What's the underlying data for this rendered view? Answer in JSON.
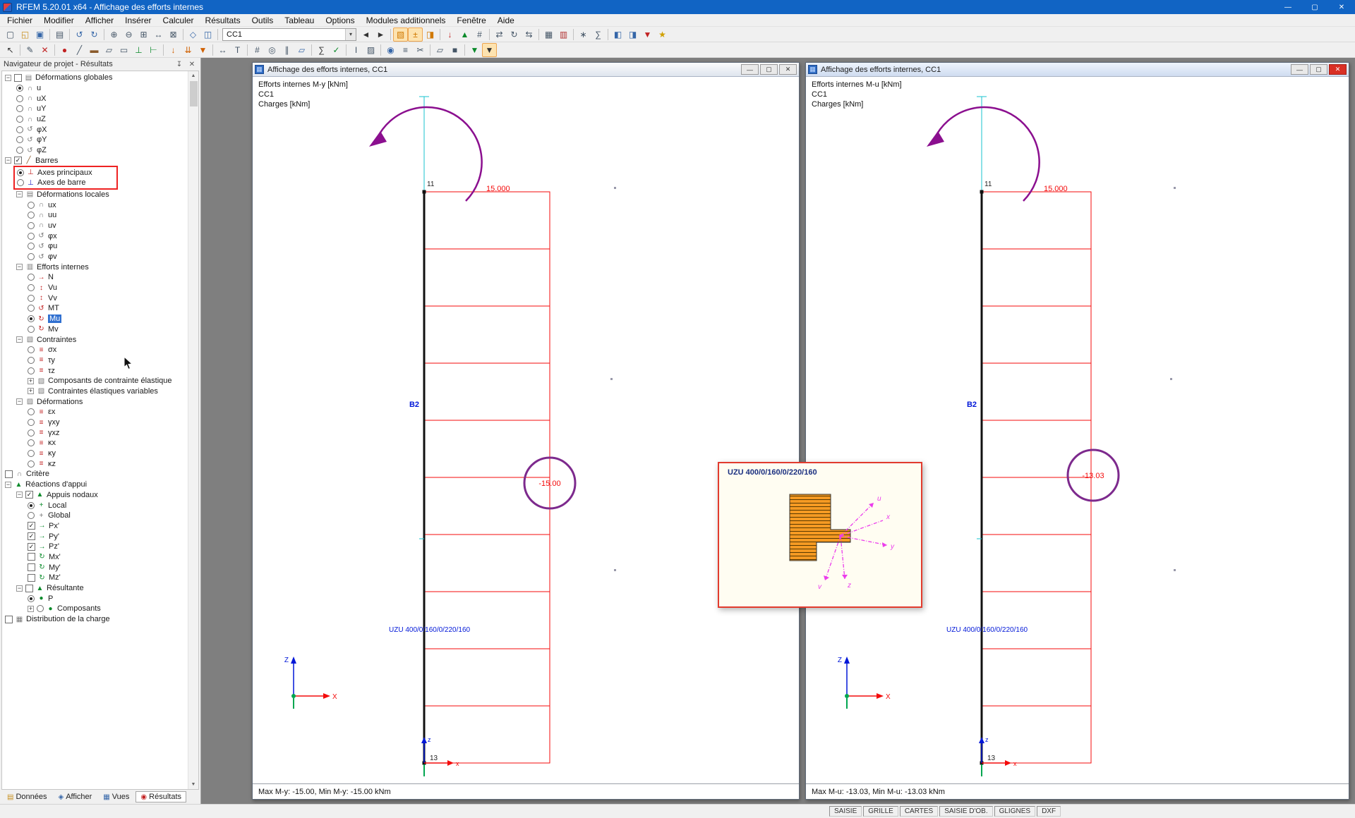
{
  "titlebar": {
    "title": "RFEM 5.20.01 x64 - Affichage des efforts internes"
  },
  "glyphs": {
    "minimize": "—",
    "maximize": "▢",
    "close": "✕",
    "pin": "↧",
    "dropdown": "▾",
    "window": "▦",
    "scroll_up": "▲",
    "scroll_down": "▼"
  },
  "menu": {
    "items": [
      "Fichier",
      "Modifier",
      "Afficher",
      "Insérer",
      "Calculer",
      "Résultats",
      "Outils",
      "Tableau",
      "Options",
      "Modules additionnels",
      "Fenêtre",
      "Aide"
    ]
  },
  "toolbars": {
    "row1": [
      {
        "n": "new-file-button",
        "g": "▢",
        "c": "#456"
      },
      {
        "n": "open-file-button",
        "g": "◱",
        "c": "#c89020"
      },
      {
        "n": "save-button",
        "g": "▣",
        "c": "#3566a8"
      },
      {
        "t": "s"
      },
      {
        "n": "print-button",
        "g": "▤",
        "c": "#456"
      },
      {
        "t": "s"
      },
      {
        "n": "undo-button",
        "g": "↺",
        "c": "#3566a8"
      },
      {
        "n": "redo-button",
        "g": "↻",
        "c": "#3566a8"
      },
      {
        "t": "s"
      },
      {
        "n": "zoom-in-button",
        "g": "⊕",
        "c": "#456"
      },
      {
        "n": "zoom-out-button",
        "g": "⊖",
        "c": "#456"
      },
      {
        "n": "zoom-window-button",
        "g": "⊞",
        "c": "#456"
      },
      {
        "n": "pan-button",
        "g": "↔",
        "c": "#456"
      },
      {
        "n": "zoom-all-button",
        "g": "⊠",
        "c": "#456"
      },
      {
        "t": "s"
      },
      {
        "n": "isometric-view-button",
        "g": "◇",
        "c": "#3566a8"
      },
      {
        "n": "view-xz-button",
        "g": "◫",
        "c": "#3566a8"
      },
      {
        "t": "s"
      },
      {
        "t": "combo",
        "v": "CC1"
      },
      {
        "n": "previous-load-case-button",
        "g": "◄",
        "c": "#333"
      },
      {
        "n": "next-load-case-button",
        "g": "►",
        "c": "#333"
      },
      {
        "t": "s"
      },
      {
        "n": "show-results-button",
        "g": "▧",
        "c": "#d07800",
        "hl": 1
      },
      {
        "n": "show-result-values-button",
        "g": "±",
        "c": "#d07800",
        "hl": 1
      },
      {
        "n": "result-panel-button",
        "g": "◨",
        "c": "#d07800"
      },
      {
        "t": "s"
      },
      {
        "n": "show-loads-button",
        "g": "↓",
        "c": "#c22222"
      },
      {
        "n": "show-supports-button",
        "g": "▲",
        "c": "#0a8a2a"
      },
      {
        "n": "numbering-button",
        "g": "#",
        "c": "#456"
      },
      {
        "t": "s"
      },
      {
        "n": "move-copy-button",
        "g": "⇄",
        "c": "#456"
      },
      {
        "n": "rotate-button",
        "g": "↻",
        "c": "#456"
      },
      {
        "n": "mirror-button",
        "g": "⇆",
        "c": "#456"
      },
      {
        "t": "s"
      },
      {
        "n": "tables-button",
        "g": "▦",
        "c": "#456"
      },
      {
        "n": "printout-report-button",
        "g": "▥",
        "c": "#b03030"
      },
      {
        "t": "s"
      },
      {
        "n": "modules-button",
        "g": "∗",
        "c": "#456"
      },
      {
        "n": "calculation-button",
        "g": "∑",
        "c": "#456"
      },
      {
        "t": "s"
      },
      {
        "n": "panel-left-button",
        "g": "◧",
        "c": "#3566a8"
      },
      {
        "n": "panel-right-button",
        "g": "◨",
        "c": "#3566a8"
      },
      {
        "n": "pdf-export-button",
        "g": "▼",
        "c": "#c22222"
      },
      {
        "n": "settings-button",
        "g": "★",
        "c": "#d0a000"
      }
    ],
    "row2": [
      {
        "n": "select-button",
        "g": "↖",
        "c": "#333"
      },
      {
        "t": "s"
      },
      {
        "n": "edit-mode-button",
        "g": "✎",
        "c": "#456"
      },
      {
        "n": "delete-button",
        "g": "✕",
        "c": "#c22222"
      },
      {
        "t": "s"
      },
      {
        "n": "new-node-button",
        "g": "●",
        "c": "#c22222"
      },
      {
        "n": "new-line-button",
        "g": "╱",
        "c": "#456"
      },
      {
        "n": "new-member-button",
        "g": "▬",
        "c": "#8a5a2a"
      },
      {
        "n": "new-surface-button",
        "g": "▱",
        "c": "#456"
      },
      {
        "n": "new-opening-button",
        "g": "▭",
        "c": "#456"
      },
      {
        "n": "nodal-support-button",
        "g": "⊥",
        "c": "#0a8a2a"
      },
      {
        "n": "line-support-button",
        "g": "⊢",
        "c": "#0a8a2a"
      },
      {
        "t": "s"
      },
      {
        "n": "nodal-load-button",
        "g": "↓",
        "c": "#d06000"
      },
      {
        "n": "member-load-button",
        "g": "⇊",
        "c": "#d06000"
      },
      {
        "n": "surface-load-button",
        "g": "▼",
        "c": "#d06000"
      },
      {
        "t": "s"
      },
      {
        "n": "dimension-button",
        "g": "↔",
        "c": "#456"
      },
      {
        "n": "comment-button",
        "g": "T",
        "c": "#456"
      },
      {
        "t": "s"
      },
      {
        "n": "grid-button",
        "g": "#",
        "c": "#456"
      },
      {
        "n": "snap-button",
        "g": "◎",
        "c": "#456"
      },
      {
        "n": "guidelines-button",
        "g": "∥",
        "c": "#456"
      },
      {
        "n": "work-plane-button",
        "g": "▱",
        "c": "#3566a8"
      },
      {
        "t": "s"
      },
      {
        "n": "calculate-button",
        "g": "∑",
        "c": "#333"
      },
      {
        "n": "check-model-button",
        "g": "✓",
        "c": "#0a8a2a"
      },
      {
        "t": "s"
      },
      {
        "n": "cross-section-button",
        "g": "I",
        "c": "#456"
      },
      {
        "n": "material-button",
        "g": "▨",
        "c": "#456"
      },
      {
        "t": "s"
      },
      {
        "n": "visibility-button",
        "g": "◉",
        "c": "#3566a8"
      },
      {
        "n": "layers-button",
        "g": "≡",
        "c": "#456"
      },
      {
        "n": "clip-button",
        "g": "✂",
        "c": "#456"
      },
      {
        "t": "s"
      },
      {
        "n": "wireframe-button",
        "g": "▱",
        "c": "#456"
      },
      {
        "n": "solid-view-button",
        "g": "■",
        "c": "#456"
      },
      {
        "t": "s"
      },
      {
        "n": "color-scale-button",
        "g": "▼",
        "c": "#0a8a2a"
      },
      {
        "n": "display-properties-button",
        "g": "▼",
        "c": "#333",
        "hl": 1
      }
    ]
  },
  "navigator": {
    "title": "Navigateur de projet - Résultats",
    "tree": [
      {
        "l": 0,
        "e": "m",
        "c": "c0",
        "i": "global-deformations-icon",
        "g": "▤",
        "k": "#777",
        "t": "Déformations globales"
      },
      {
        "l": 1,
        "c": "r1",
        "i": "deformation-u-icon",
        "g": "∩",
        "k": "#777",
        "t": "u"
      },
      {
        "l": 1,
        "c": "r0",
        "i": "deformation-ux-icon",
        "g": "∩",
        "k": "#777",
        "t": "uX"
      },
      {
        "l": 1,
        "c": "r0",
        "i": "deformation-uy-icon",
        "g": "∩",
        "k": "#777",
        "t": "uY"
      },
      {
        "l": 1,
        "c": "r0",
        "i": "deformation-uz-icon",
        "g": "∩",
        "k": "#777",
        "t": "uZ"
      },
      {
        "l": 1,
        "c": "r0",
        "i": "rotation-phix-icon",
        "g": "↺",
        "k": "#777",
        "t": "φX"
      },
      {
        "l": 1,
        "c": "r0",
        "i": "rotation-phiy-icon",
        "g": "↺",
        "k": "#777",
        "t": "φY"
      },
      {
        "l": 1,
        "c": "r0",
        "i": "rotation-phiz-icon",
        "g": "↺",
        "k": "#777",
        "t": "φZ"
      },
      {
        "l": 0,
        "e": "m",
        "c": "c1",
        "i": "members-icon",
        "g": "╱",
        "k": "#8a5a2a",
        "t": "Barres"
      },
      {
        "l": 1,
        "c": "r1",
        "i": "principal-axes-icon",
        "g": "⊥",
        "k": "#c22222",
        "t": "Axes principaux",
        "grp": 1
      },
      {
        "l": 1,
        "c": "r0",
        "i": "member-axes-icon",
        "g": "⊥",
        "k": "#2222c2",
        "t": "Axes de barre",
        "grp": 1
      },
      {
        "l": 1,
        "e": "m",
        "i": "local-deformations-icon",
        "g": "▤",
        "k": "#777",
        "t": "Déformations locales"
      },
      {
        "l": 2,
        "c": "r0",
        "i": "deformation-ux-icon",
        "g": "∩",
        "k": "#777",
        "t": "ux"
      },
      {
        "l": 2,
        "c": "r0",
        "i": "deformation-uu-icon",
        "g": "∩",
        "k": "#777",
        "t": "uu"
      },
      {
        "l": 2,
        "c": "r0",
        "i": "deformation-uv-icon",
        "g": "∩",
        "k": "#777",
        "t": "uv"
      },
      {
        "l": 2,
        "c": "r0",
        "i": "rotation-phix-icon",
        "g": "↺",
        "k": "#777",
        "t": "φx"
      },
      {
        "l": 2,
        "c": "r0",
        "i": "rotation-phiu-icon",
        "g": "↺",
        "k": "#777",
        "t": "φu"
      },
      {
        "l": 2,
        "c": "r0",
        "i": "rotation-phiv-icon",
        "g": "↺",
        "k": "#777",
        "t": "φv"
      },
      {
        "l": 1,
        "e": "m",
        "i": "internal-forces-icon",
        "g": "▥",
        "k": "#777",
        "t": "Efforts internes"
      },
      {
        "l": 2,
        "c": "r0",
        "i": "axial-force-icon",
        "g": "→",
        "k": "#c22222",
        "t": "N"
      },
      {
        "l": 2,
        "c": "r0",
        "i": "shear-vu-icon",
        "g": "↕",
        "k": "#c22222",
        "t": "Vu"
      },
      {
        "l": 2,
        "c": "r0",
        "i": "shear-vv-icon",
        "g": "↕",
        "k": "#c22222",
        "t": "Vv"
      },
      {
        "l": 2,
        "c": "r0",
        "i": "torsion-mt-icon",
        "g": "↺",
        "k": "#c22222",
        "t": "MT"
      },
      {
        "l": 2,
        "c": "r1",
        "i": "moment-mu-icon",
        "g": "↻",
        "k": "#c22222",
        "t": "Mu",
        "sel": 1
      },
      {
        "l": 2,
        "c": "r0",
        "i": "moment-mv-icon",
        "g": "↻",
        "k": "#c22222",
        "t": "Mv"
      },
      {
        "l": 1,
        "e": "m",
        "i": "stresses-icon",
        "g": "▧",
        "k": "#777",
        "t": "Contraintes"
      },
      {
        "l": 2,
        "c": "r0",
        "i": "stress-sigma-x-icon",
        "g": "≡",
        "k": "#c22222",
        "t": "σx"
      },
      {
        "l": 2,
        "c": "r0",
        "i": "stress-tau-y-icon",
        "g": "≡",
        "k": "#c22222",
        "t": "τy"
      },
      {
        "l": 2,
        "c": "r0",
        "i": "stress-tau-z-icon",
        "g": "≡",
        "k": "#c22222",
        "t": "τz"
      },
      {
        "l": 2,
        "e": "p",
        "i": "stress-components-icon",
        "g": "▧",
        "k": "#777",
        "t": "Composants de contrainte élastique"
      },
      {
        "l": 2,
        "e": "p",
        "i": "variable-stresses-icon",
        "g": "▧",
        "k": "#777",
        "t": "Contraintes élastiques variables"
      },
      {
        "l": 1,
        "e": "m",
        "i": "strains-icon",
        "g": "▨",
        "k": "#777",
        "t": "Déformations"
      },
      {
        "l": 2,
        "c": "r0",
        "i": "strain-epsilon-x-icon",
        "g": "≡",
        "k": "#c22222",
        "t": "εx"
      },
      {
        "l": 2,
        "c": "r0",
        "i": "strain-gamma-xy-icon",
        "g": "≡",
        "k": "#c22222",
        "t": "γxy"
      },
      {
        "l": 2,
        "c": "r0",
        "i": "strain-gamma-xz-icon",
        "g": "≡",
        "k": "#c22222",
        "t": "γxz"
      },
      {
        "l": 2,
        "c": "r0",
        "i": "strain-kappa-x-icon",
        "g": "≡",
        "k": "#c22222",
        "t": "κx"
      },
      {
        "l": 2,
        "c": "r0",
        "i": "strain-kappa-y-icon",
        "g": "≡",
        "k": "#c22222",
        "t": "κy"
      },
      {
        "l": 2,
        "c": "r0",
        "i": "strain-kappa-z-icon",
        "g": "≡",
        "k": "#c22222",
        "t": "κz"
      },
      {
        "l": 0,
        "c": "c0",
        "i": "criterion-icon",
        "g": "∩",
        "k": "#777",
        "t": "Critère"
      },
      {
        "l": 0,
        "e": "m",
        "i": "support-reactions-icon",
        "g": "▲",
        "k": "#0a8a2a",
        "t": "Réactions d'appui"
      },
      {
        "l": 1,
        "e": "m",
        "c": "c1",
        "i": "nodal-supports-icon",
        "g": "▲",
        "k": "#0a8a2a",
        "t": "Appuis nodaux"
      },
      {
        "l": 2,
        "c": "r1",
        "i": "local-system-icon",
        "g": "+",
        "k": "#0a8a2a",
        "t": "Local"
      },
      {
        "l": 2,
        "c": "r0",
        "i": "global-system-icon",
        "g": "+",
        "k": "#777",
        "t": "Global"
      },
      {
        "l": 2,
        "c": "c1",
        "i": "reaction-px-icon",
        "g": "→",
        "k": "#0a8a2a",
        "t": "Px'"
      },
      {
        "l": 2,
        "c": "c1",
        "i": "reaction-py-icon",
        "g": "→",
        "k": "#0a8a2a",
        "t": "Py'"
      },
      {
        "l": 2,
        "c": "c1",
        "i": "reaction-pz-icon",
        "g": "→",
        "k": "#0a8a2a",
        "t": "Pz'"
      },
      {
        "l": 2,
        "c": "c0",
        "i": "reaction-mx-icon",
        "g": "↻",
        "k": "#0a8a2a",
        "t": "Mx'"
      },
      {
        "l": 2,
        "c": "c0",
        "i": "reaction-my-icon",
        "g": "↻",
        "k": "#0a8a2a",
        "t": "My'"
      },
      {
        "l": 2,
        "c": "c0",
        "i": "reaction-mz-icon",
        "g": "↻",
        "k": "#0a8a2a",
        "t": "Mz'"
      },
      {
        "l": 1,
        "e": "m",
        "c": "c0",
        "i": "resultant-icon",
        "g": "▲",
        "k": "#0a8a2a",
        "t": "Résultante"
      },
      {
        "l": 2,
        "c": "r1",
        "i": "resultant-p-icon",
        "g": "●",
        "k": "#0a8a2a",
        "t": "P"
      },
      {
        "l": 2,
        "e": "p",
        "c": "r0",
        "i": "components-icon",
        "g": "●",
        "k": "#0a8a2a",
        "t": "Composants"
      },
      {
        "l": 0,
        "c": "c0",
        "i": "load-distribution-icon",
        "g": "▦",
        "k": "#777",
        "t": "Distribution de la charge"
      }
    ],
    "tabs": [
      {
        "label": "Données",
        "glyph": "▤"
      },
      {
        "label": "Afficher",
        "glyph": "◈"
      },
      {
        "label": "Vues",
        "glyph": "▦"
      },
      {
        "label": "Résultats",
        "glyph": "◉"
      }
    ]
  },
  "mdi": {
    "windows": [
      {
        "title": "Affichage des efforts internes, CC1",
        "legend": [
          "Efforts internes M-y [kNm]",
          "CC1",
          "Charges [kNm]"
        ],
        "moment_label": "15.000",
        "value_circle": "-15.00",
        "node_top": "11",
        "node_bottom": "13",
        "member": "B2",
        "section": "UZU 400/0/160/0/220/160",
        "axis_x": "X",
        "axis_z": "Z",
        "axis_x_small": "x",
        "axis_z_small": "z",
        "status": "Max M-y: -15.00, Min M-y: -15.00 kNm"
      },
      {
        "title": "Affichage des efforts internes, CC1",
        "legend": [
          "Efforts internes M-u [kNm]",
          "CC1",
          "Charges [kNm]"
        ],
        "moment_label": "15.000",
        "value_circle": "-13.03",
        "node_top": "11",
        "node_bottom": "13",
        "member": "B2",
        "section": "UZU 400/0/160/0/220/160",
        "axis_x": "X",
        "axis_z": "Z",
        "axis_x_small": "x",
        "axis_z_small": "z",
        "status": "Max M-u: -13.03, Min M-u: -13.03 kNm"
      }
    ]
  },
  "popup": {
    "title": "UZU 400/0/160/0/220/160",
    "axes": {
      "u": "u",
      "v": "v",
      "x": "x",
      "y": "y",
      "z": "z"
    }
  },
  "statusbar": {
    "panels": [
      "SAISIE",
      "GRILLE",
      "CARTES",
      "SAISIE D'OB.",
      "GLIGNES",
      "DXF"
    ]
  }
}
